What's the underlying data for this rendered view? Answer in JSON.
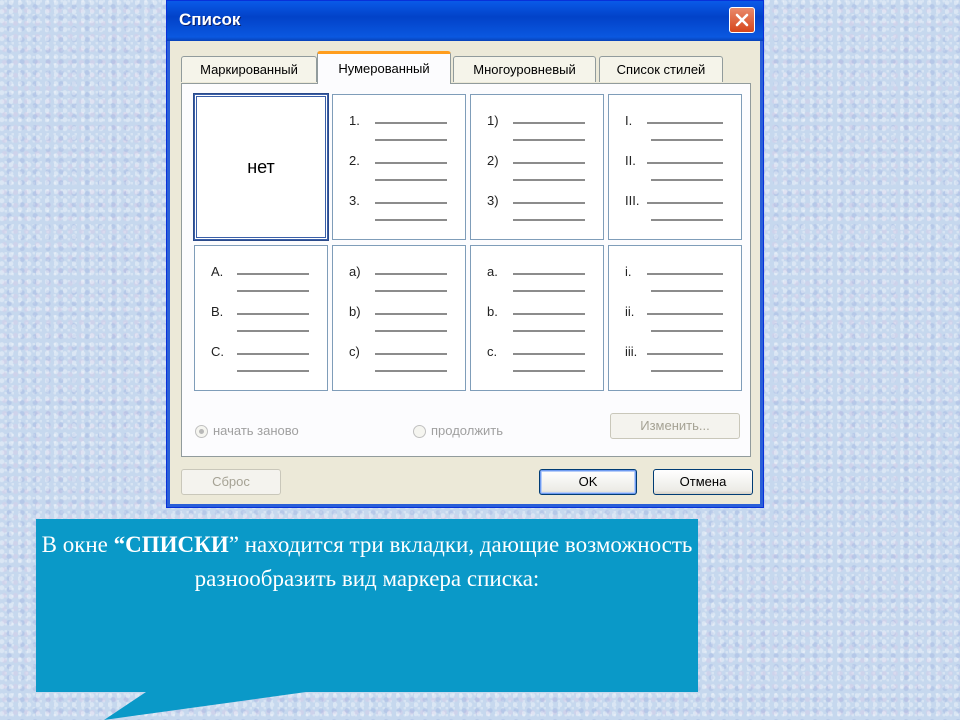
{
  "dialog": {
    "title": "Список",
    "tabs": [
      {
        "label": "Маркированный",
        "active": false
      },
      {
        "label": "Нумерованный",
        "active": true
      },
      {
        "label": "Многоуровневый",
        "active": false
      },
      {
        "label": "Список стилей",
        "active": false
      }
    ],
    "styles": [
      {
        "name": "none",
        "label": "нет",
        "selected": true,
        "markers": []
      },
      {
        "name": "arabic-dot",
        "markers": [
          "1.",
          "2.",
          "3."
        ]
      },
      {
        "name": "arabic-paren",
        "markers": [
          "1)",
          "2)",
          "3)"
        ]
      },
      {
        "name": "roman-upper",
        "markers": [
          "I.",
          "II.",
          "III."
        ]
      },
      {
        "name": "alpha-upper",
        "markers": [
          "A.",
          "B.",
          "C."
        ]
      },
      {
        "name": "alpha-lower-paren",
        "markers": [
          "a)",
          "b)",
          "c)"
        ]
      },
      {
        "name": "alpha-lower-dot",
        "markers": [
          "a.",
          "b.",
          "c."
        ]
      },
      {
        "name": "roman-lower",
        "markers": [
          "i.",
          "ii.",
          "iii."
        ]
      }
    ],
    "restart_label": "начать заново",
    "continue_label": "продолжить",
    "customize_label": "Изменить...",
    "reset_label": "Сброс",
    "ok_label": "OK",
    "cancel_label": "Отмена",
    "colors": {
      "title_bar": "#0a5ae8",
      "close": "#d6461c",
      "active_tab_accent": "#ff9d1e"
    }
  },
  "callout": {
    "text_before": "В окне ",
    "text_bold": "“СПИСКИ",
    "text_after": "” находится три вкладки, дающие возможность разнообразить вид маркера списка:",
    "color": "#0a99c8"
  }
}
